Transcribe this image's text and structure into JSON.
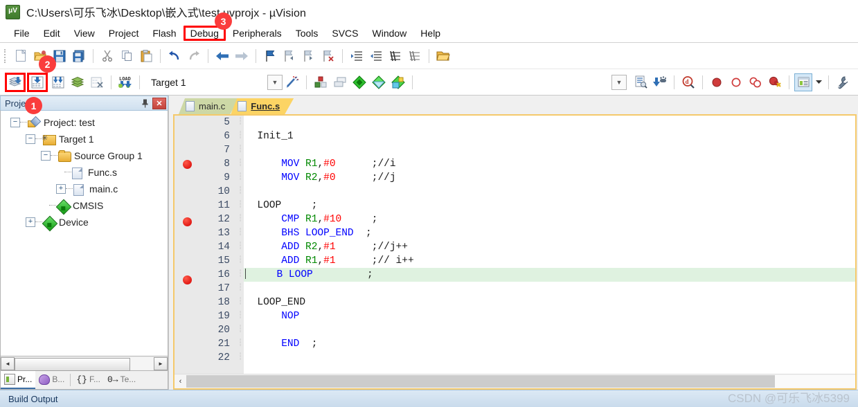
{
  "window": {
    "title": "C:\\Users\\可乐飞冰\\Desktop\\嵌入式\\test.uvprojx - µVision",
    "app_icon": "uvision-icon"
  },
  "menubar": {
    "items": [
      {
        "label": "File",
        "highlighted": false
      },
      {
        "label": "Edit",
        "highlighted": false
      },
      {
        "label": "View",
        "highlighted": false
      },
      {
        "label": "Project",
        "highlighted": false
      },
      {
        "label": "Flash",
        "highlighted": false
      },
      {
        "label": "Debug",
        "highlighted": true
      },
      {
        "label": "Peripherals",
        "highlighted": false
      },
      {
        "label": "Tools",
        "highlighted": false
      },
      {
        "label": "SVCS",
        "highlighted": false
      },
      {
        "label": "Window",
        "highlighted": false
      },
      {
        "label": "Help",
        "highlighted": false
      }
    ]
  },
  "toolbar_main": {
    "icons": [
      "new-file-icon",
      "open-file-icon",
      "save-icon",
      "save-all-icon",
      "cut-icon",
      "copy-icon",
      "paste-icon",
      "undo-icon",
      "redo-icon",
      "navigate-back-icon",
      "navigate-forward-icon",
      "bookmark-toggle-icon",
      "bookmark-prev-icon",
      "bookmark-next-icon",
      "bookmark-clear-icon",
      "indent-icon",
      "outdent-icon",
      "comment-icon",
      "uncomment-icon",
      "open-folder-icon"
    ]
  },
  "toolbar_build": {
    "build_icon": "translate-file-icon",
    "build_target_icon": "build-target-icon",
    "rebuild_icon": "rebuild-all-icon",
    "batch_build_icon": "batch-build-icon",
    "stop_build_icon": "stop-build-icon",
    "download_icon": "load-download-icon",
    "target_name": "Target 1",
    "dropdown_icon": "chevron-down-icon",
    "magic_wand_icon": "target-options-icon",
    "manage_items": [
      "manage-project-items-icon",
      "manage-multi-project-icon",
      "cmsis-pack-icon",
      "pack-installer-icon",
      "pack-manager-icon"
    ],
    "right_icons": [
      "chevron-down-icon",
      "insert-definition-icon",
      "navigate-symbol-icon",
      "find-in-files-icon",
      "breakpoint-insert-icon",
      "breakpoint-disable-icon",
      "breakpoint-disable-all-icon",
      "breakpoint-kill-all-icon",
      "project-window-icon",
      "chevron-down-small-icon",
      "configuration-wizard-icon"
    ]
  },
  "project_panel": {
    "title": "Project",
    "pin_icon": "pin-icon",
    "close_icon": "close-icon",
    "tree": [
      {
        "label": "Project: test",
        "indent": 0,
        "expander": "minus",
        "icon": "project-icon"
      },
      {
        "label": "Target 1",
        "indent": 1,
        "expander": "minus",
        "icon": "target-folder-icon"
      },
      {
        "label": "Source Group 1",
        "indent": 2,
        "expander": "minus",
        "icon": "folder-icon"
      },
      {
        "label": "Func.s",
        "indent": 3,
        "expander": "none",
        "icon": "source-file-icon"
      },
      {
        "label": "main.c",
        "indent": 3,
        "expander": "plus",
        "icon": "source-file-icon"
      },
      {
        "label": "CMSIS",
        "indent": 2,
        "expander": "none",
        "icon": "component-icon"
      },
      {
        "label": "Device",
        "indent": 1,
        "expander": "plus",
        "icon": "component-icon"
      }
    ],
    "scroll": {
      "left_arrow": "◄",
      "right_arrow": "►"
    },
    "tabs": [
      {
        "label": "Pr...",
        "icon": "project-window-icon",
        "active": true
      },
      {
        "label": "B...",
        "icon": "books-icon",
        "active": false
      },
      {
        "label": "F...",
        "icon": "functions-icon",
        "active": false
      },
      {
        "label": "Te...",
        "icon": "templates-icon",
        "active": false
      }
    ]
  },
  "editor": {
    "tabs": [
      {
        "label": "main.c",
        "active": false
      },
      {
        "label": "Func.s",
        "active": true
      }
    ],
    "lines": [
      {
        "number": "5",
        "breakpoint": false,
        "current": false,
        "tokens": []
      },
      {
        "number": "6",
        "breakpoint": false,
        "current": false,
        "tokens": [
          {
            "t": "  Init_1",
            "c": "lbl-c"
          }
        ]
      },
      {
        "number": "7",
        "breakpoint": false,
        "current": false,
        "tokens": []
      },
      {
        "number": "8",
        "breakpoint": true,
        "current": false,
        "tokens": [
          {
            "t": "      ",
            "c": "punct"
          },
          {
            "t": "MOV",
            "c": "kw"
          },
          {
            "t": " ",
            "c": "punct"
          },
          {
            "t": "R1",
            "c": "reg"
          },
          {
            "t": ",",
            "c": "punct"
          },
          {
            "t": "#0",
            "c": "num"
          },
          {
            "t": "      ;//i",
            "c": "cmt"
          }
        ]
      },
      {
        "number": "9",
        "breakpoint": false,
        "current": false,
        "tokens": [
          {
            "t": "      ",
            "c": "punct"
          },
          {
            "t": "MOV",
            "c": "kw"
          },
          {
            "t": " ",
            "c": "punct"
          },
          {
            "t": "R2",
            "c": "reg"
          },
          {
            "t": ",",
            "c": "punct"
          },
          {
            "t": "#0",
            "c": "num"
          },
          {
            "t": "      ;//j",
            "c": "cmt"
          }
        ]
      },
      {
        "number": "10",
        "breakpoint": false,
        "current": false,
        "tokens": []
      },
      {
        "number": "11",
        "breakpoint": false,
        "current": false,
        "tokens": [
          {
            "t": "  LOOP     ;",
            "c": "lbl-c"
          }
        ]
      },
      {
        "number": "12",
        "breakpoint": true,
        "current": false,
        "tokens": [
          {
            "t": "      ",
            "c": "punct"
          },
          {
            "t": "CMP",
            "c": "kw"
          },
          {
            "t": " ",
            "c": "punct"
          },
          {
            "t": "R1",
            "c": "reg"
          },
          {
            "t": ",",
            "c": "punct"
          },
          {
            "t": "#10",
            "c": "num"
          },
          {
            "t": "     ;",
            "c": "cmt"
          }
        ]
      },
      {
        "number": "13",
        "breakpoint": false,
        "current": false,
        "tokens": [
          {
            "t": "      ",
            "c": "punct"
          },
          {
            "t": "BHS LOOP_END",
            "c": "kw"
          },
          {
            "t": "  ;",
            "c": "cmt"
          }
        ]
      },
      {
        "number": "14",
        "breakpoint": false,
        "current": false,
        "tokens": [
          {
            "t": "      ",
            "c": "punct"
          },
          {
            "t": "ADD",
            "c": "kw"
          },
          {
            "t": " ",
            "c": "punct"
          },
          {
            "t": "R2",
            "c": "reg"
          },
          {
            "t": ",",
            "c": "punct"
          },
          {
            "t": "#1",
            "c": "num"
          },
          {
            "t": "      ;//j++",
            "c": "cmt"
          }
        ]
      },
      {
        "number": "15",
        "breakpoint": false,
        "current": false,
        "tokens": [
          {
            "t": "      ",
            "c": "punct"
          },
          {
            "t": "ADD",
            "c": "kw"
          },
          {
            "t": " ",
            "c": "punct"
          },
          {
            "t": "R1",
            "c": "reg"
          },
          {
            "t": ",",
            "c": "punct"
          },
          {
            "t": "#1",
            "c": "num"
          },
          {
            "t": "      ;// i++",
            "c": "cmt"
          }
        ]
      },
      {
        "number": "16",
        "breakpoint": true,
        "current": true,
        "tokens": [
          {
            "t": "     ",
            "c": "punct"
          },
          {
            "t": "B LOOP",
            "c": "kw"
          },
          {
            "t": "         ;",
            "c": "cmt"
          }
        ]
      },
      {
        "number": "17",
        "breakpoint": false,
        "current": false,
        "tokens": []
      },
      {
        "number": "18",
        "breakpoint": false,
        "current": false,
        "tokens": [
          {
            "t": "  LOOP_END",
            "c": "lbl-c"
          }
        ]
      },
      {
        "number": "19",
        "breakpoint": false,
        "current": false,
        "tokens": [
          {
            "t": "      ",
            "c": "punct"
          },
          {
            "t": "NOP",
            "c": "kw"
          }
        ]
      },
      {
        "number": "20",
        "breakpoint": false,
        "current": false,
        "tokens": []
      },
      {
        "number": "21",
        "breakpoint": false,
        "current": false,
        "tokens": [
          {
            "t": "      ",
            "c": "punct"
          },
          {
            "t": "END",
            "c": "kw"
          },
          {
            "t": "  ;",
            "c": "cmt"
          }
        ]
      },
      {
        "number": "22",
        "breakpoint": false,
        "current": false,
        "tokens": []
      }
    ],
    "scroll_left_icon": "‹"
  },
  "bottom": {
    "build_output_label": "Build Output"
  },
  "annotations": [
    {
      "id": "1",
      "label": "1",
      "target": "project-panel"
    },
    {
      "id": "2",
      "label": "2",
      "target": "build-toolbar"
    },
    {
      "id": "3",
      "label": "3",
      "target": "debug-menu"
    }
  ],
  "watermark": {
    "text": "CSDN @可乐飞冰5399"
  },
  "colors": {
    "annotation_red": "#fa3c3c",
    "active_tab": "#fcd464",
    "inactive_tab": "#cdd8a6",
    "breakpoint": "#d40000",
    "current_line": "#dff2e0",
    "keyword": "#0000ff",
    "register": "#008800",
    "number": "#ff0000",
    "panel_header": "#cfe0ef"
  }
}
